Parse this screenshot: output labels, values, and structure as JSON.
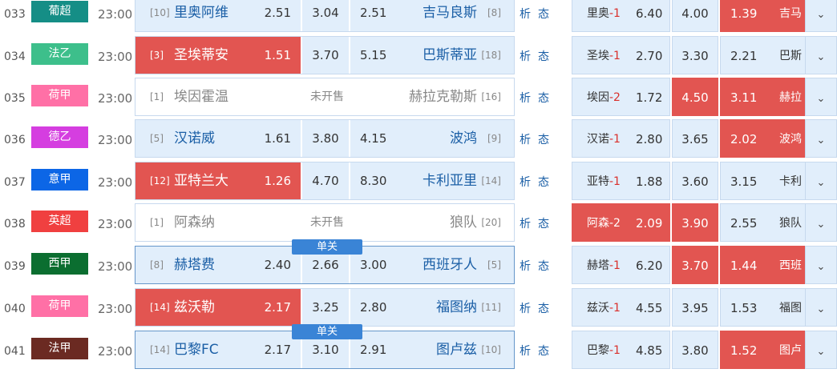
{
  "labels": {
    "analysis": "析",
    "status": "态",
    "not_on_sale": "未开售",
    "single": "单关",
    "expand_icon": "⌄"
  },
  "matches": [
    {
      "num": "033",
      "league": "葡超",
      "league_color": "#158e86",
      "time": "23:00",
      "home_rank": "[10]",
      "home": "里奥阿维",
      "h": "2.51",
      "d": "3.04",
      "a": "2.51",
      "away": "吉马良斯",
      "away_rank": "[8]",
      "hcp_team": "里奥",
      "hcp": "-1",
      "hw": "6.40",
      "hd": "4.00",
      "ha": "1.39",
      "hcp_away": "吉马",
      "red": [],
      "hred": [
        "a"
      ],
      "nosale": false,
      "single": false
    },
    {
      "num": "034",
      "league": "法乙",
      "league_color": "#3dbf8b",
      "time": "23:00",
      "home_rank": "[3]",
      "home": "圣埃蒂安",
      "h": "1.51",
      "d": "3.70",
      "a": "5.15",
      "away": "巴斯蒂亚",
      "away_rank": "[18]",
      "hcp_team": "圣埃",
      "hcp": "-1",
      "hw": "2.70",
      "hd": "3.30",
      "ha": "2.21",
      "hcp_away": "巴斯",
      "red": [
        "h"
      ],
      "hred": [],
      "nosale": false,
      "single": false
    },
    {
      "num": "035",
      "league": "荷甲",
      "league_color": "#ff70a6",
      "time": "23:00",
      "home_rank": "[1]",
      "home": "埃因霍温",
      "h": "",
      "d": "",
      "a": "",
      "away": "赫拉克勒斯",
      "away_rank": "[16]",
      "hcp_team": "埃因",
      "hcp": "-2",
      "hw": "1.72",
      "hd": "4.50",
      "ha": "3.11",
      "hcp_away": "赫拉",
      "red": [],
      "hred": [
        "d",
        "a"
      ],
      "nosale": true,
      "single": false
    },
    {
      "num": "036",
      "league": "德乙",
      "league_color": "#d53ee0",
      "time": "23:00",
      "home_rank": "[5]",
      "home": "汉诺威",
      "h": "1.61",
      "d": "3.80",
      "a": "4.15",
      "away": "波鸿",
      "away_rank": "[9]",
      "hcp_team": "汉诺",
      "hcp": "-1",
      "hw": "2.80",
      "hd": "3.65",
      "ha": "2.02",
      "hcp_away": "波鸿",
      "red": [],
      "hred": [
        "a"
      ],
      "nosale": false,
      "single": false
    },
    {
      "num": "037",
      "league": "意甲",
      "league_color": "#0c66e6",
      "time": "23:00",
      "home_rank": "[12]",
      "home": "亚特兰大",
      "h": "1.26",
      "d": "4.70",
      "a": "8.30",
      "away": "卡利亚里",
      "away_rank": "[14]",
      "hcp_team": "亚特",
      "hcp": "-1",
      "hw": "1.88",
      "hd": "3.60",
      "ha": "3.15",
      "hcp_away": "卡利",
      "red": [
        "h"
      ],
      "hred": [],
      "nosale": false,
      "single": false
    },
    {
      "num": "038",
      "league": "英超",
      "league_color": "#f04040",
      "time": "23:00",
      "home_rank": "[1]",
      "home": "阿森纳",
      "h": "",
      "d": "",
      "a": "",
      "away": "狼队",
      "away_rank": "[20]",
      "hcp_team": "阿森",
      "hcp": "-2",
      "hw": "2.09",
      "hd": "3.90",
      "ha": "2.55",
      "hcp_away": "狼队",
      "red": [],
      "hred": [
        "h",
        "d"
      ],
      "nosale": true,
      "single": false
    },
    {
      "num": "039",
      "league": "西甲",
      "league_color": "#0b6e30",
      "time": "23:00",
      "home_rank": "[8]",
      "home": "赫塔费",
      "h": "2.40",
      "d": "2.66",
      "a": "3.00",
      "away": "西班牙人",
      "away_rank": "[5]",
      "hcp_team": "赫塔",
      "hcp": "-1",
      "hw": "6.20",
      "hd": "3.70",
      "ha": "1.44",
      "hcp_away": "西班",
      "red": [],
      "hred": [
        "d",
        "a"
      ],
      "nosale": false,
      "single": true
    },
    {
      "num": "040",
      "league": "荷甲",
      "league_color": "#ff70a6",
      "time": "23:00",
      "home_rank": "[14]",
      "home": "兹沃勒",
      "h": "2.17",
      "d": "3.25",
      "a": "2.80",
      "away": "福图纳",
      "away_rank": "[11]",
      "hcp_team": "兹沃",
      "hcp": "-1",
      "hw": "4.55",
      "hd": "3.95",
      "ha": "1.53",
      "hcp_away": "福图",
      "red": [
        "h"
      ],
      "hred": [],
      "nosale": false,
      "single": false
    },
    {
      "num": "041",
      "league": "法甲",
      "league_color": "#6b2a22",
      "time": "23:00",
      "home_rank": "[14]",
      "home": "巴黎FC",
      "h": "2.17",
      "d": "3.10",
      "a": "2.91",
      "away": "图卢兹",
      "away_rank": "[10]",
      "hcp_team": "巴黎",
      "hcp": "-1",
      "hw": "4.85",
      "hd": "3.80",
      "ha": "1.52",
      "hcp_away": "图卢",
      "red": [],
      "hred": [
        "a"
      ],
      "nosale": false,
      "single": true
    }
  ]
}
